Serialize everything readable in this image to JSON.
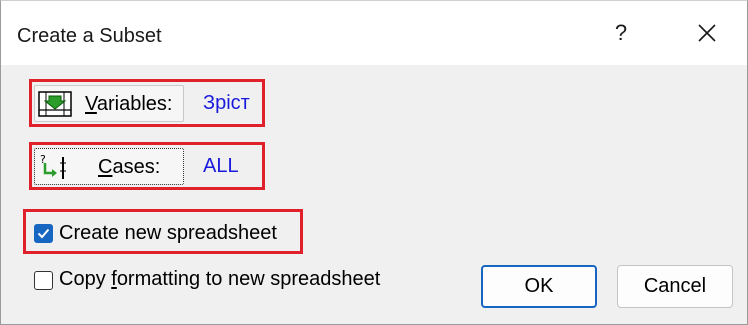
{
  "window": {
    "title": "Create a Subset",
    "help_glyph": "?",
    "close_glyph": "✕"
  },
  "variables": {
    "label_hotkey": "V",
    "label_rest": "ariables:",
    "value": "Зріст",
    "icon": "variables-icon"
  },
  "cases": {
    "label_hotkey": "C",
    "label_rest": "ases:",
    "value": "ALL",
    "icon": "cases-icon"
  },
  "options": {
    "create_new": {
      "label": "Create new spreadsheet",
      "checked": true
    },
    "copy_formatting": {
      "label_pre": "Copy ",
      "label_hotkey": "f",
      "label_post": "ormatting to new spreadsheet",
      "checked": false
    }
  },
  "buttons": {
    "ok": "OK",
    "cancel": "Cancel"
  },
  "colors": {
    "highlight_border": "#e0202a",
    "value_text": "#1a1adc",
    "checkbox_accent": "#1766c1"
  }
}
